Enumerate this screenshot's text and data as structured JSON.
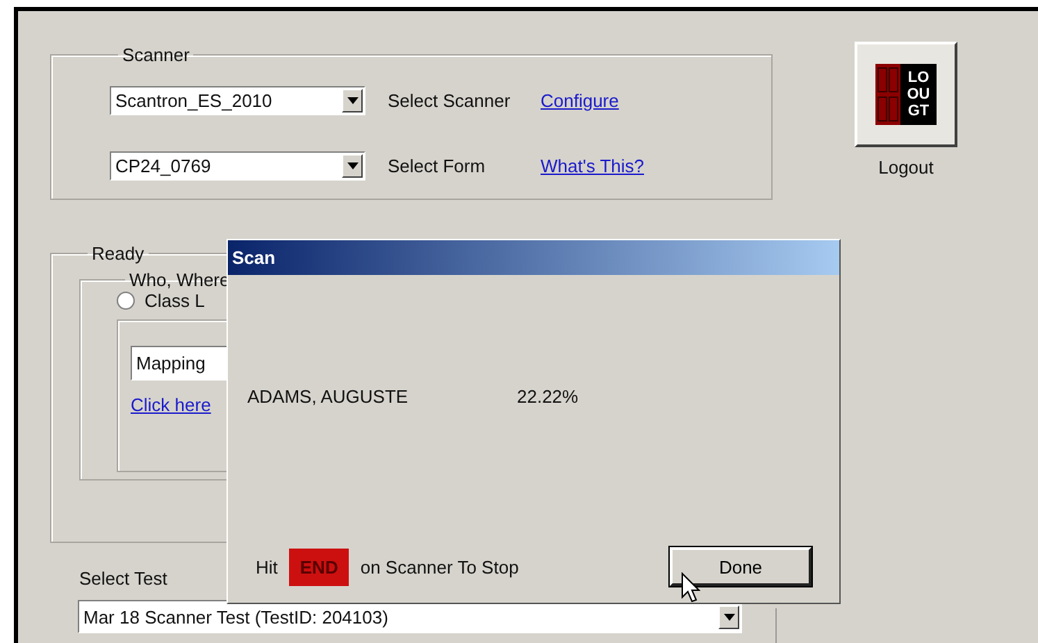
{
  "scanner_group": {
    "title": "Scanner",
    "rows": [
      {
        "value": "Scantron_ES_2010",
        "label": "Select Scanner",
        "link": "Configure"
      },
      {
        "value": "CP24_0769",
        "label": "Select Form",
        "link": "What's This?"
      }
    ]
  },
  "logout": {
    "logo_lines": [
      "LO",
      "OU",
      "GT"
    ],
    "label": "Logout"
  },
  "ready_group": {
    "title": "Ready",
    "who_where": {
      "title": "Who, Where",
      "radio": {
        "label": "Class L",
        "selected": false
      },
      "field_value": "Mapping",
      "link": "Click here"
    }
  },
  "select_test": {
    "label": "Select Test",
    "value": "Mar 18 Scanner Test  (TestID: 204103)"
  },
  "dialog": {
    "title": "Scan",
    "student": "ADAMS, AUGUSTE",
    "percent": "22.22%",
    "hint_before": "Hit",
    "key": "END",
    "hint_after": "on Scanner To Stop",
    "button": "Done"
  }
}
